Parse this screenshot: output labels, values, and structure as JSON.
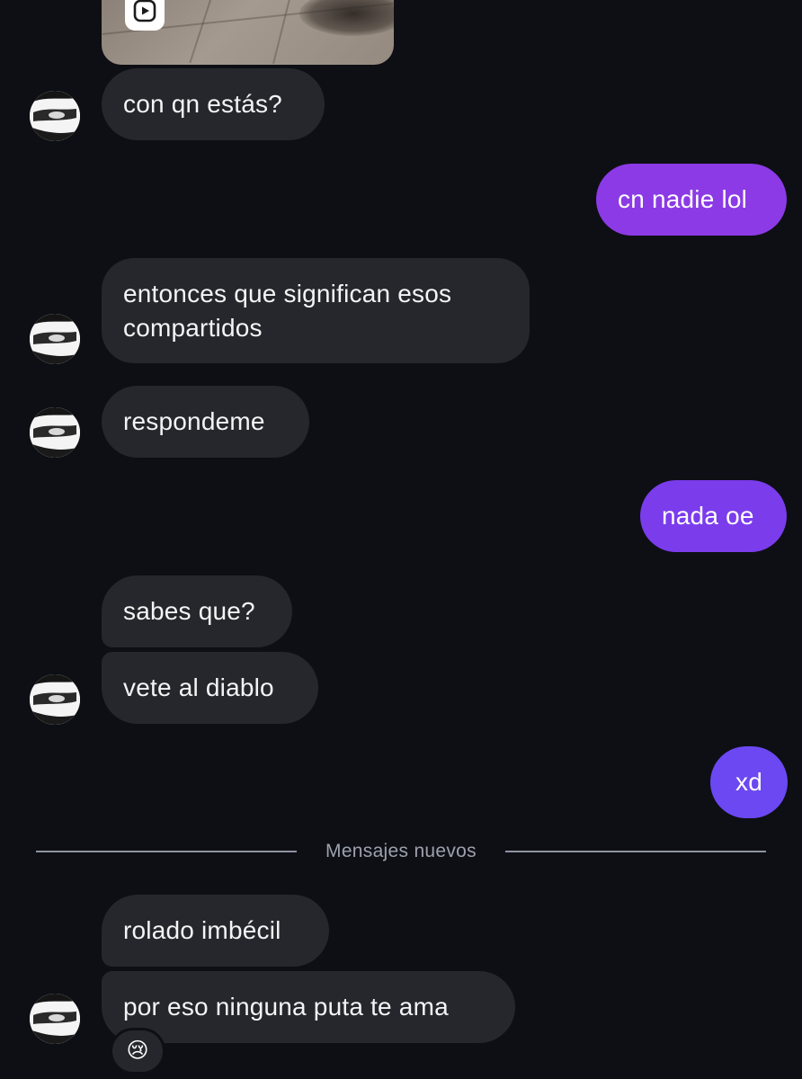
{
  "thread": {
    "messages": [
      {
        "id": "m1",
        "side": "incoming",
        "text": "con qn estás?"
      },
      {
        "id": "m2",
        "side": "outgoing",
        "text": "cn nadie lol",
        "color": "#8c3ae6"
      },
      {
        "id": "m3",
        "side": "incoming",
        "text": "entonces que significan esos compartidos"
      },
      {
        "id": "m4",
        "side": "incoming",
        "text": "respondeme"
      },
      {
        "id": "m5",
        "side": "outgoing",
        "text": "nada oe",
        "color": "#7b3cec"
      },
      {
        "id": "m6",
        "side": "incoming",
        "text": "sabes que?"
      },
      {
        "id": "m7",
        "side": "incoming",
        "text": "vete al diablo"
      },
      {
        "id": "m8",
        "side": "outgoing",
        "text": "xd",
        "color": "#6b48f2"
      },
      {
        "id": "m9",
        "side": "incoming",
        "text": "rolado imbécil"
      },
      {
        "id": "m10",
        "side": "incoming",
        "text": "por eso ninguna puta te ama"
      }
    ],
    "new_messages_label": "Mensajes nuevos",
    "last_reaction": "😢",
    "shared_media_icon": "reel-play-icon"
  },
  "colors": {
    "background": "#0d0f14",
    "incoming_bubble": "#25272c",
    "divider": "#8e93a0"
  }
}
